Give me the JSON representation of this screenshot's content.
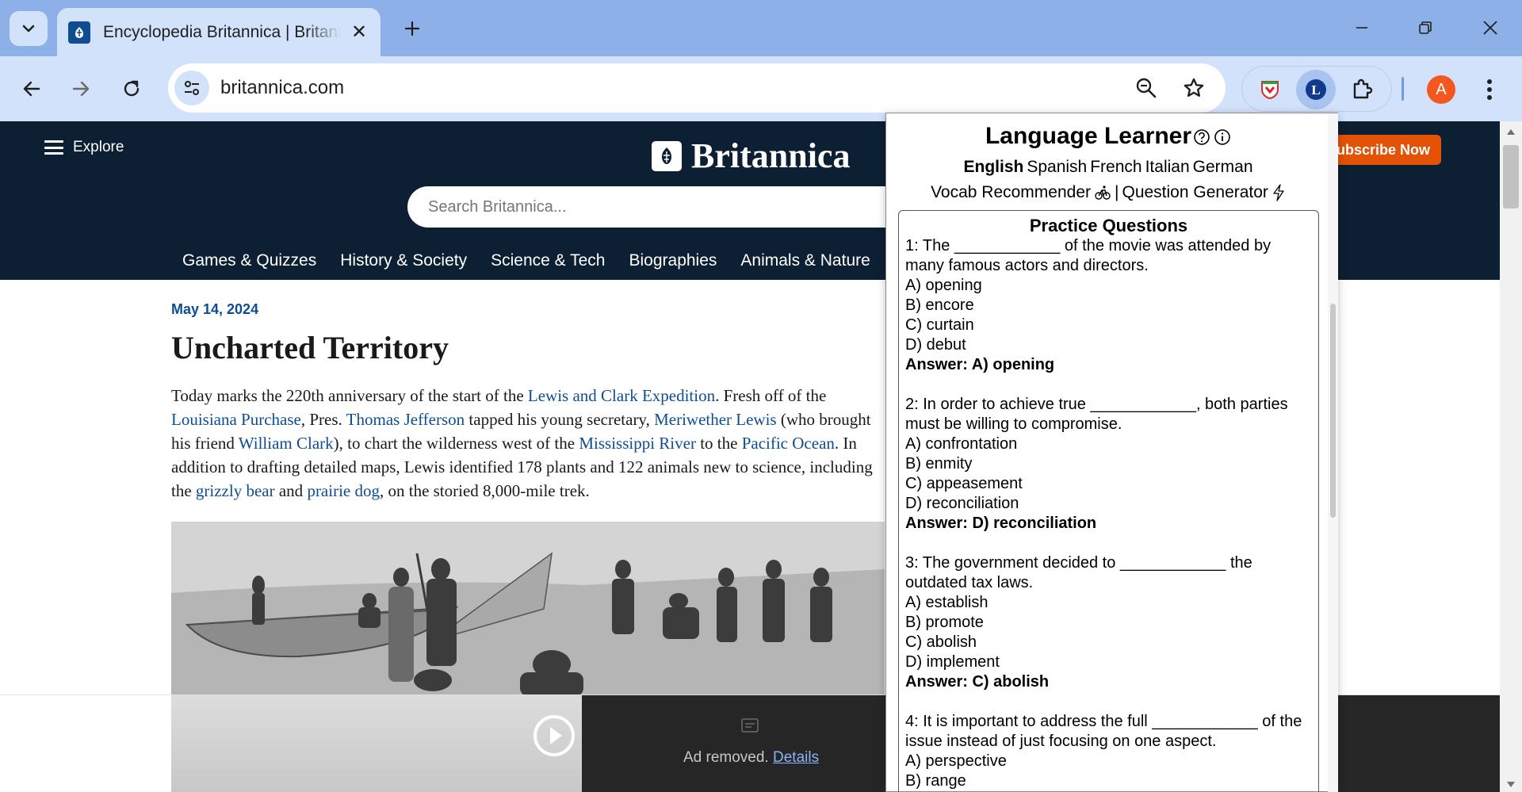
{
  "browser": {
    "tab_title": "Encyclopedia Britannica | Britannica",
    "url": "britannica.com",
    "profile_initial": "A"
  },
  "site": {
    "explore_label": "Explore",
    "logo_text": "Britannica",
    "subscribe_label": "Subscribe Now",
    "search_placeholder": "Search Britannica...",
    "nav": [
      "Games & Quizzes",
      "History & Society",
      "Science & Tech",
      "Biographies",
      "Animals & Nature"
    ]
  },
  "article": {
    "date": "May 14, 2024",
    "headline": "Uncharted Territory",
    "body": [
      {
        "t": "Today marks the 220th anniversary of the start of the "
      },
      {
        "t": "Lewis and Clark Expedition",
        "link": true
      },
      {
        "t": ". Fresh off of the "
      },
      {
        "t": "Louisiana Purchase",
        "link": true
      },
      {
        "t": ", Pres. "
      },
      {
        "t": "Thomas Jefferson",
        "link": true
      },
      {
        "t": " tapped his young secretary, "
      },
      {
        "t": "Meriwether Lewis",
        "link": true
      },
      {
        "t": " (who brought his friend "
      },
      {
        "t": "William Clark",
        "link": true
      },
      {
        "t": "), to chart the wilderness west of the "
      },
      {
        "t": "Mississippi River",
        "link": true
      },
      {
        "t": " to the "
      },
      {
        "t": "Pacific Ocean",
        "link": true
      },
      {
        "t": ". In addition to drafting detailed maps, Lewis identified 178 plants and 122 animals new to science, including the "
      },
      {
        "t": "grizzly bear",
        "link": true
      },
      {
        "t": " and "
      },
      {
        "t": "prairie dog",
        "link": true
      },
      {
        "t": ", on the storied 8,000-mile trek."
      }
    ]
  },
  "ad": {
    "removed_text": "Ad removed.",
    "details_link": "Details"
  },
  "extension": {
    "title": "Language Learner",
    "languages": [
      {
        "name": "English",
        "active": true
      },
      {
        "name": "Spanish",
        "active": false
      },
      {
        "name": "French",
        "active": false
      },
      {
        "name": "Italian",
        "active": false
      },
      {
        "name": "German",
        "active": false
      }
    ],
    "vocab_label": "Vocab Recommender",
    "separator": "|",
    "question_label": "Question Generator",
    "panel_heading": "Practice Questions",
    "questions": [
      {
        "text": "1: The ____________ of the movie was attended by many famous actors and directors.",
        "options": [
          "A) opening",
          "B) encore",
          "C) curtain",
          "D) debut"
        ],
        "answer": "Answer: A) opening"
      },
      {
        "text": "2: In order to achieve true ____________, both parties must be willing to compromise.",
        "options": [
          "A) confrontation",
          "B) enmity",
          "C) appeasement",
          "D) reconciliation"
        ],
        "answer": "Answer: D) reconciliation"
      },
      {
        "text": "3: The government decided to ____________ the outdated tax laws.",
        "options": [
          "A) establish",
          "B) promote",
          "C) abolish",
          "D) implement"
        ],
        "answer": "Answer: C) abolish"
      },
      {
        "text": "4: It is important to address the full ____________ of the issue instead of just focusing on one aspect.",
        "options": [
          "A) perspective",
          "B) range"
        ],
        "answer": ""
      }
    ]
  },
  "colors": {
    "header_bg": "#0d1f33",
    "link": "#0f4d92",
    "subscribe": "#e35205",
    "chrome_tabstrip": "#8db0e8",
    "chrome_toolbar": "#d3e2fb"
  }
}
